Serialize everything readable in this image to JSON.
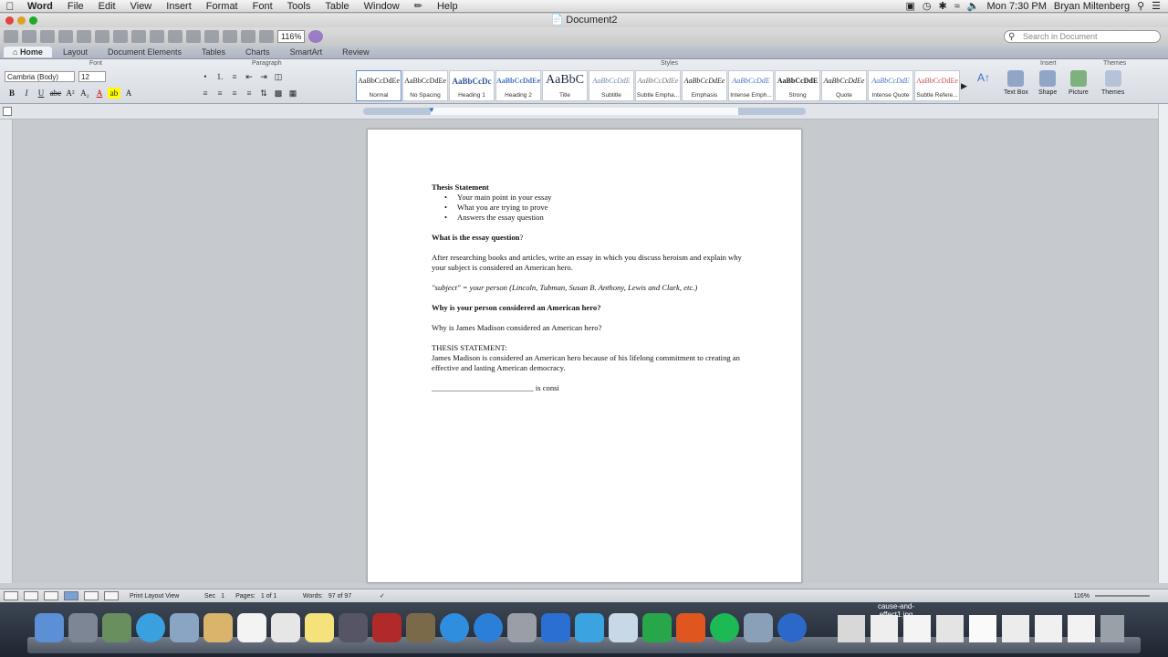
{
  "menubar": {
    "app": "Word",
    "items": [
      "File",
      "Edit",
      "View",
      "Insert",
      "Format",
      "Font",
      "Tools",
      "Table",
      "Window",
      "Help"
    ],
    "clock": "Mon 7:30 PM",
    "user": "Bryan Miltenberg"
  },
  "window": {
    "title": "Document2"
  },
  "toolbar": {
    "zoom": "116%",
    "search_placeholder": "Search in Document"
  },
  "ribbon_tabs": [
    "Home",
    "Layout",
    "Document Elements",
    "Tables",
    "Charts",
    "SmartArt",
    "Review"
  ],
  "ribbon": {
    "groups": {
      "font": "Font",
      "paragraph": "Paragraph",
      "styles": "Styles",
      "insert": "Insert",
      "themes": "Themes"
    },
    "font_name": "Cambria (Body)",
    "font_size": "12",
    "styles": [
      {
        "preview": "AaBbCcDdEe",
        "name": "Normal"
      },
      {
        "preview": "AaBbCcDdEe",
        "name": "No Spacing"
      },
      {
        "preview": "AaBbCcDc",
        "name": "Heading 1"
      },
      {
        "preview": "AaBbCcDdEe",
        "name": "Heading 2"
      },
      {
        "preview": "AaBbC",
        "name": "Title"
      },
      {
        "preview": "AaBbCcDdE",
        "name": "Subtitle"
      },
      {
        "preview": "AaBbCcDdEe",
        "name": "Subtle Empha..."
      },
      {
        "preview": "AaBbCcDdEe",
        "name": "Emphasis"
      },
      {
        "preview": "AaBbCcDdE",
        "name": "Intense Emph..."
      },
      {
        "preview": "AaBbCcDdE",
        "name": "Strong"
      },
      {
        "preview": "AaBbCcDdEe",
        "name": "Quote"
      },
      {
        "preview": "AaBbCcDdE",
        "name": "Intense Quote"
      },
      {
        "preview": "AaBbCcDdEe",
        "name": "Subtle Refere..."
      }
    ],
    "insert": [
      "Text Box",
      "Shape",
      "Picture"
    ],
    "themes": "Themes"
  },
  "document": {
    "h1": "Thesis Statement",
    "bullets": [
      "Your main point in your essay",
      "What you are trying to prove",
      "Answers the essay question"
    ],
    "q1": "What is the essay question",
    "q1_mark": "?",
    "p1": "After researching books and articles, write an essay in which you discuss heroism and explain why your subject is considered an American hero.",
    "p2": "\"subject\" = your person (Lincoln, Tubman, Susan B. Anthony, Lewis and Clark, etc.)",
    "h2": "Why is your person considered an American hero?",
    "p3": "Why is James Madison considered an American hero?",
    "p4_label": "THESIS STATEMENT:",
    "p4": "James Madison is considered an American hero because of his lifelong commitment to creating an effective and lasting American democracy.",
    "p5_blank": "__________________________",
    "p5": " is consi"
  },
  "statusbar": {
    "view": "Print Layout View",
    "sec_label": "Sec",
    "sec": "1",
    "pages_label": "Pages:",
    "pages": "1 of 1",
    "words_label": "Words:",
    "words": "97 of 97",
    "zoom": "116%"
  },
  "dock": {
    "tooltip": "cause-and-effect1.jpg"
  }
}
